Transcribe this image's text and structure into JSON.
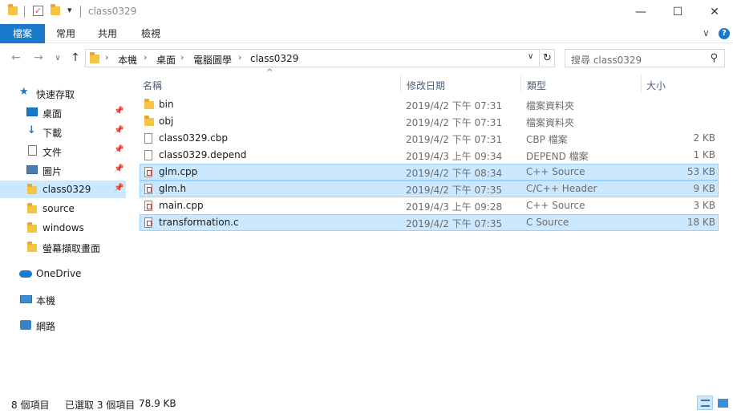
{
  "window": {
    "title": "class0329",
    "minimize": "—",
    "maximize": "☐",
    "close": "✕"
  },
  "ribbon": {
    "tabs": [
      "檔案",
      "常用",
      "共用",
      "檢視"
    ],
    "expand": "∨",
    "help": "?"
  },
  "nav": {
    "back": "←",
    "forward": "→",
    "recent": "∨",
    "up": "↑",
    "breadcrumb": [
      "本機",
      "桌面",
      "電腦圖學",
      "class0329"
    ],
    "sep": "›",
    "dropdown": "∨",
    "refresh": "↻"
  },
  "search": {
    "placeholder": "搜尋 class0329",
    "icon": "⚲"
  },
  "sidebar": {
    "quick_access": "快速存取",
    "items": [
      {
        "label": "桌面",
        "icon": "desktop-icon",
        "pinned": true
      },
      {
        "label": "下載",
        "icon": "download-icon",
        "pinned": true
      },
      {
        "label": "文件",
        "icon": "document-icon",
        "pinned": true
      },
      {
        "label": "圖片",
        "icon": "picture-icon",
        "pinned": true
      },
      {
        "label": "class0329",
        "icon": "folder-icon",
        "pinned": true
      },
      {
        "label": "source",
        "icon": "folder-icon",
        "pinned": false
      },
      {
        "label": "windows",
        "icon": "folder-icon",
        "pinned": false
      },
      {
        "label": "螢幕擷取畫面",
        "icon": "folder-icon",
        "pinned": false
      }
    ],
    "onedrive": "OneDrive",
    "this_pc": "本機",
    "network": "網路",
    "pin_glyph": "📌"
  },
  "list": {
    "columns": {
      "name": "名稱",
      "date": "修改日期",
      "type": "類型",
      "size": "大小"
    },
    "sort_caret": "^",
    "rows": [
      {
        "name": "bin",
        "date": "2019/4/2 下午 07:31",
        "type": "檔案資料夾",
        "size": "",
        "icon": "folder-icon",
        "selected": false
      },
      {
        "name": "obj",
        "date": "2019/4/2 下午 07:31",
        "type": "檔案資料夾",
        "size": "",
        "icon": "folder-icon",
        "selected": false
      },
      {
        "name": "class0329.cbp",
        "date": "2019/4/2 下午 07:31",
        "type": "CBP 檔案",
        "size": "2 KB",
        "icon": "file-icon",
        "selected": false
      },
      {
        "name": "class0329.depend",
        "date": "2019/4/3 上午 09:34",
        "type": "DEPEND 檔案",
        "size": "1 KB",
        "icon": "file-icon",
        "selected": false
      },
      {
        "name": "glm.cpp",
        "date": "2019/4/2 下午 08:34",
        "type": "C++ Source",
        "size": "53 KB",
        "icon": "cpp-source-icon",
        "selected": true
      },
      {
        "name": "glm.h",
        "date": "2019/4/2 下午 07:35",
        "type": "C/C++ Header",
        "size": "9 KB",
        "icon": "header-icon",
        "selected": true
      },
      {
        "name": "main.cpp",
        "date": "2019/4/3 上午 09:28",
        "type": "C++ Source",
        "size": "3 KB",
        "icon": "cpp-source-icon",
        "selected": false
      },
      {
        "name": "transformation.c",
        "date": "2019/4/2 下午 07:35",
        "type": "C Source",
        "size": "18 KB",
        "icon": "c-source-icon",
        "selected": true
      }
    ]
  },
  "status": {
    "count": "8 個項目",
    "selected": "已選取 3 個項目",
    "size": "78.9 KB"
  }
}
